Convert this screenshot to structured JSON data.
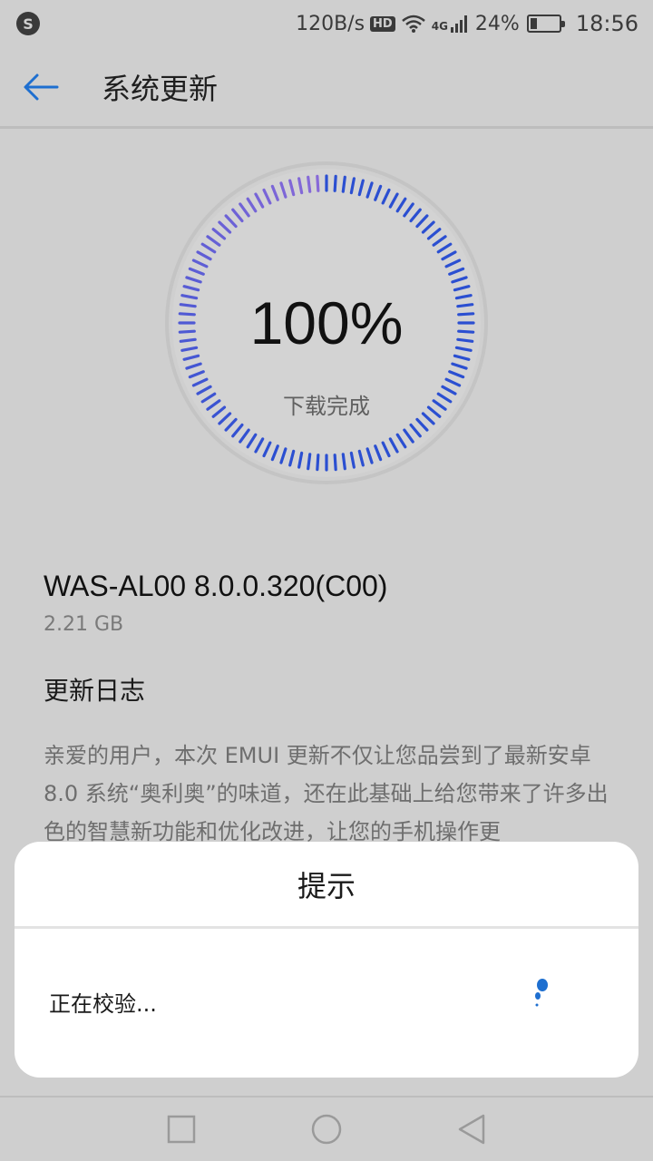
{
  "status_bar": {
    "app_glyph": "S",
    "speed": "120B/s",
    "hd": "HD",
    "network": "4G",
    "battery_percent": "24%",
    "battery_level": 0.24,
    "time": "18:56"
  },
  "header": {
    "title": "系统更新",
    "back_icon": "arrow-left-icon"
  },
  "progress": {
    "percent": "100%",
    "value": 1.0,
    "label": "下载完成"
  },
  "update": {
    "version": "WAS-AL00 8.0.0.320(C00)",
    "size": "2.21 GB",
    "log_title": "更新日志",
    "log_body": "亲爱的用户，本次 EMUI 更新不仅让您品尝到了最新安卓 8.0 系统“奥利奥”的味道，还在此基础上给您带来了许多出色的智慧新功能和优化改进，让您的手机操作更"
  },
  "dialog": {
    "title": "提示",
    "message": "正在校验..."
  },
  "colors": {
    "accent": "#1e6fd0",
    "ring_start": "#2b4fd1",
    "ring_end": "#8a6ad8"
  },
  "nav": {
    "recent_icon": "square-icon",
    "home_icon": "circle-icon",
    "back_icon": "triangle-back-icon"
  }
}
